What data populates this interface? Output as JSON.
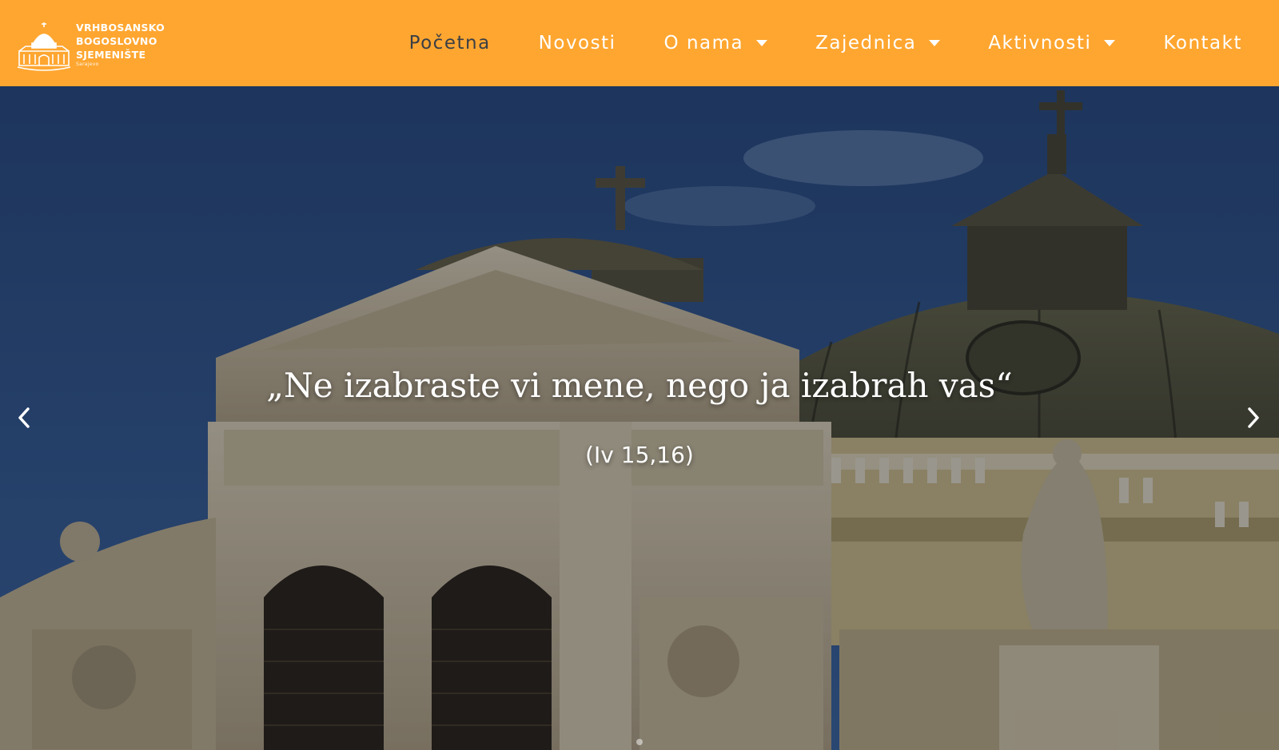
{
  "brand": {
    "lines": [
      "VRHBOSANSKO",
      "BOGOSLOVNO",
      "SJEMENIŠTE"
    ],
    "city": "Sarajevo",
    "color": "#ffa630"
  },
  "nav": {
    "items": [
      {
        "label": "Početna",
        "active": true,
        "has_dropdown": false
      },
      {
        "label": "Novosti",
        "active": false,
        "has_dropdown": false
      },
      {
        "label": "O nama",
        "active": false,
        "has_dropdown": true
      },
      {
        "label": "Zajednica",
        "active": false,
        "has_dropdown": true
      },
      {
        "label": "Aktivnosti",
        "active": false,
        "has_dropdown": true
      },
      {
        "label": "Kontakt",
        "active": false,
        "has_dropdown": false
      }
    ]
  },
  "hero": {
    "quote": "„Ne izabraste vi mene, nego ja izabrah vas“",
    "reference": "(Iv 15,16)",
    "prev_icon": "chevron-left-icon",
    "next_icon": "chevron-right-icon"
  }
}
